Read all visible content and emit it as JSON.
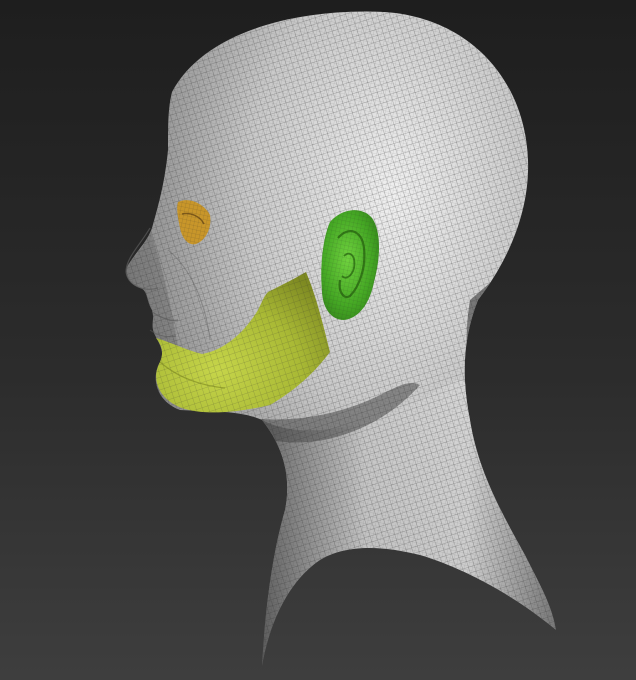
{
  "scene": {
    "subject": "",
    "colors": {
      "background_top": "#1f1f1f",
      "background_bottom": "#3d3d3d",
      "mesh_light": "#e4e4e4",
      "mesh_mid": "#9a9a9a",
      "mesh_dark": "#4a4a4a",
      "wire": "#3a3a3a",
      "polygroup_chin": "#b3c43a",
      "polygroup_ear": "#4fb52a",
      "polygroup_eye": "#c8962a"
    },
    "polygroups": [
      {
        "name": "chin-jaw",
        "color": "#b3c43a"
      },
      {
        "name": "ear",
        "color": "#4fb52a"
      },
      {
        "name": "eye",
        "color": "#c8962a"
      }
    ]
  }
}
